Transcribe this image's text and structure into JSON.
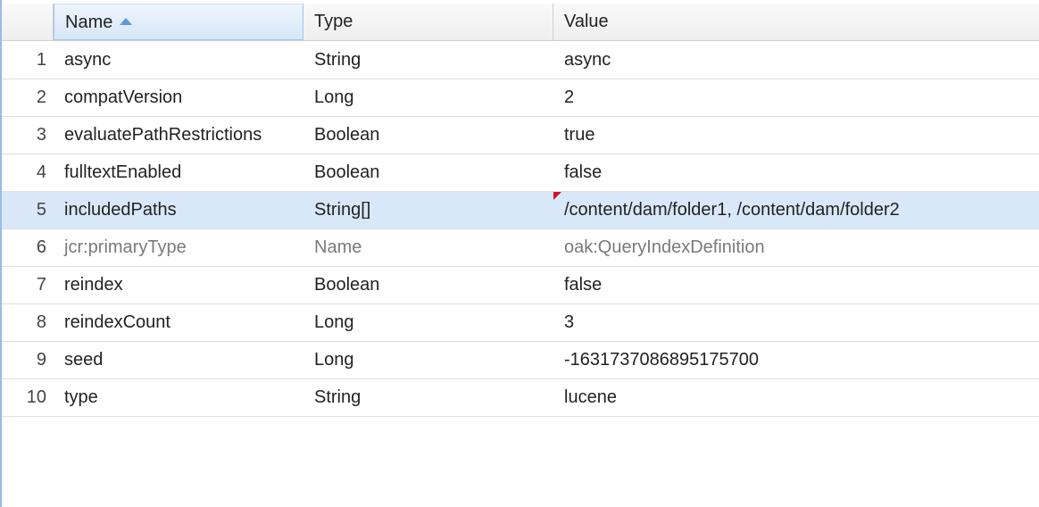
{
  "columns": {
    "number": "",
    "name": "Name",
    "type": "Type",
    "value": "Value"
  },
  "sort": {
    "column": "name",
    "direction": "ascending",
    "icon": "sort-ascending-icon"
  },
  "selected_row": 5,
  "rows": [
    {
      "num": "1",
      "name": "async",
      "type": "String",
      "value": "async"
    },
    {
      "num": "2",
      "name": "compatVersion",
      "type": "Long",
      "value": "2"
    },
    {
      "num": "3",
      "name": "evaluatePathRestrictions",
      "type": "Boolean",
      "value": "true"
    },
    {
      "num": "4",
      "name": "fulltextEnabled",
      "type": "Boolean",
      "value": "false"
    },
    {
      "num": "5",
      "name": "includedPaths",
      "type": "String[]",
      "value": "/content/dam/folder1, /content/dam/folder2"
    },
    {
      "num": "6",
      "name": "jcr:primaryType",
      "type": "Name",
      "value": "oak:QueryIndexDefinition"
    },
    {
      "num": "7",
      "name": "reindex",
      "type": "Boolean",
      "value": "false"
    },
    {
      "num": "8",
      "name": "reindexCount",
      "type": "Long",
      "value": "3"
    },
    {
      "num": "9",
      "name": "seed",
      "type": "Long",
      "value": "-1631737086895175700"
    },
    {
      "num": "10",
      "name": "type",
      "type": "String",
      "value": "lucene"
    }
  ],
  "colors": {
    "header_active": "#d6e7f8",
    "selected_row": "#d9e8f8",
    "modified_marker": "#d0102a",
    "panel_border": "#99bbe8"
  }
}
